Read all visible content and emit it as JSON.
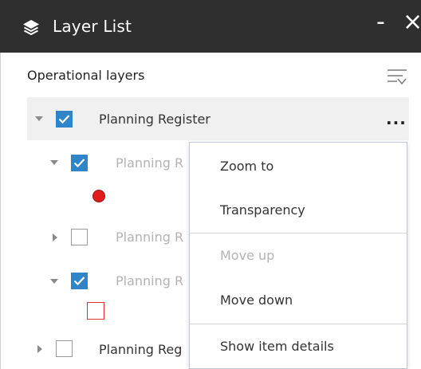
{
  "panel": {
    "title": "Layer List",
    "minimize_label": "-",
    "close_label": "×",
    "section_title": "Operational layers"
  },
  "layers": [
    {
      "label": "Planning Register",
      "checked": true,
      "expanded": true,
      "selected": true
    },
    {
      "label": "Planning R",
      "checked": true,
      "expanded": true,
      "dim": true
    },
    {
      "label": "Planning R",
      "checked": false,
      "expanded": false,
      "dim": true
    },
    {
      "label": "Planning R",
      "checked": true,
      "expanded": true,
      "dim": true
    },
    {
      "label": "Planning Reg",
      "checked": false,
      "expanded": false
    }
  ],
  "ellipsis_label": "...",
  "menu": {
    "items": [
      {
        "label": "Zoom to",
        "enabled": true
      },
      {
        "label": "Transparency",
        "enabled": true
      },
      {
        "label": "Move up",
        "enabled": false
      },
      {
        "label": "Move down",
        "enabled": true
      },
      {
        "label": "Show item details",
        "enabled": true
      }
    ]
  },
  "colors": {
    "titlebar": "#2f2f2f",
    "checkbox_checked": "#2f85c7",
    "legend_point": "#e21b1b",
    "legend_polygon_outline": "#e03030",
    "selected_row": "#f0f0f0"
  },
  "icons": {
    "title": "layers-icon",
    "filter": "filter-icon",
    "options": "more-options-icon"
  }
}
